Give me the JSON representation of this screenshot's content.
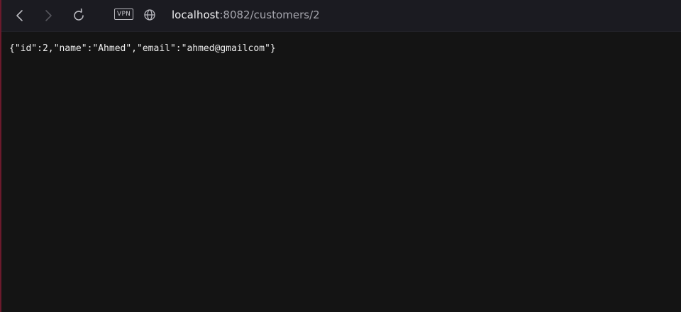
{
  "browser": {
    "toolbar": {
      "back_icon": "chevron-left-icon",
      "forward_icon": "chevron-right-icon",
      "reload_icon": "reload-icon",
      "vpn_label": "VPN",
      "site_icon": "globe-icon"
    },
    "address_bar": {
      "host": "localhost",
      "rest": ":8082/customers/2"
    }
  },
  "page": {
    "json_text": "{\"id\":2,\"name\":\"Ahmed\",\"email\":\"ahmed@gmailcom\"}"
  },
  "colors": {
    "background": "#141414",
    "toolbar": "#1b1b21",
    "accent": "#6b1a2c",
    "text": "#ececec"
  }
}
